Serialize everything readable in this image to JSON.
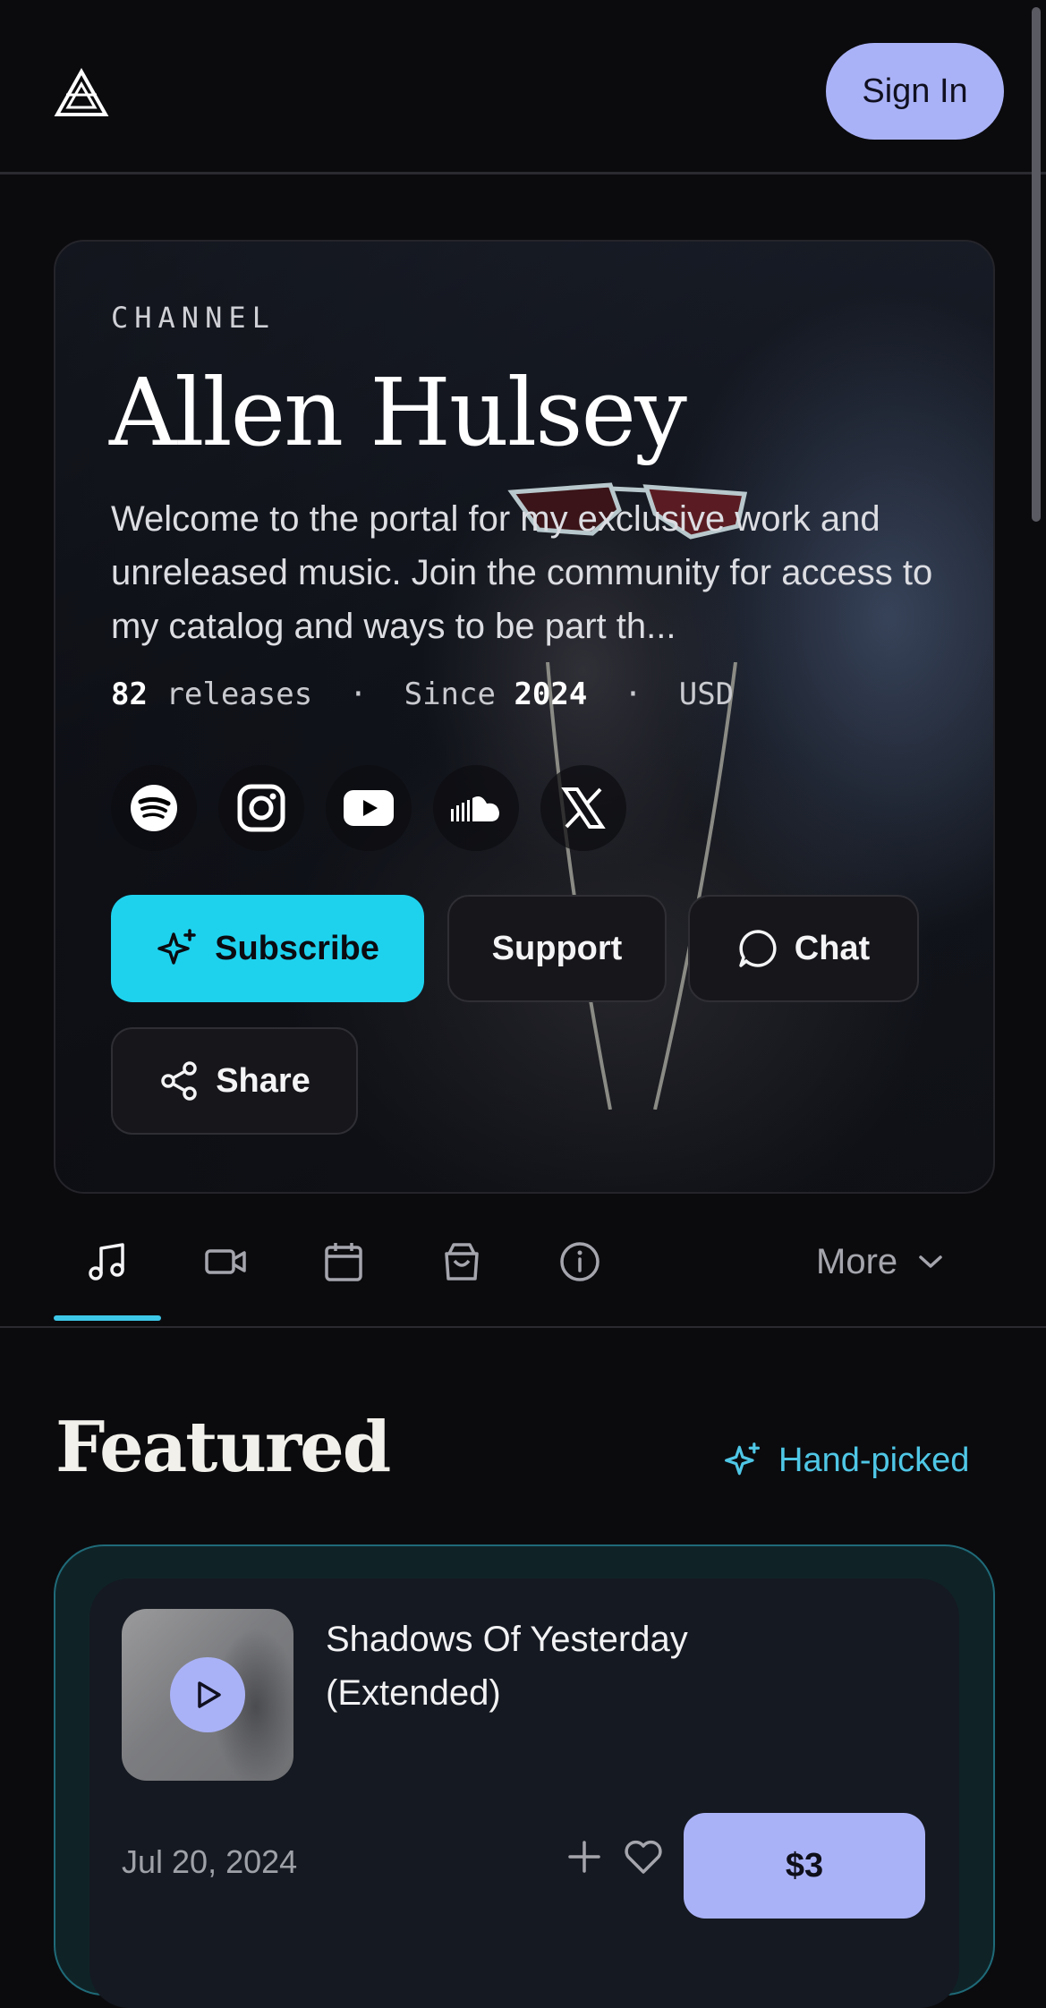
{
  "header": {
    "sign_in_label": "Sign In",
    "logo_icon": "triangle-logo-icon"
  },
  "hero": {
    "kicker": "CHANNEL",
    "name": "Allen Hulsey",
    "bio": "Welcome to the portal for my exclusive work and unreleased music. Join the community for access to my catalog and ways to be part th...",
    "meta": {
      "releases_count": "82",
      "releases_label": "releases",
      "since_label": "Since",
      "since_year": "2024",
      "currency": "USD",
      "separator": "·"
    },
    "socials": [
      "spotify-icon",
      "instagram-icon",
      "youtube-icon",
      "soundcloud-icon",
      "x-icon"
    ],
    "buttons": {
      "subscribe": "Subscribe",
      "support": "Support",
      "chat": "Chat",
      "share": "Share"
    }
  },
  "tabs": {
    "items": [
      "music-icon",
      "video-icon",
      "calendar-icon",
      "shop-bag-icon",
      "info-icon"
    ],
    "more_label": "More",
    "active_index": 0
  },
  "featured": {
    "title": "Featured",
    "badge": "Hand-picked",
    "item": {
      "title": "Shadows Of Yesterday (Extended)",
      "date": "Jul 20, 2024",
      "price": "$3"
    }
  },
  "colors": {
    "accent_cyan": "#1ed2ee",
    "accent_periwinkle": "#aab2f7",
    "background": "#0b0b0e",
    "featured_border": "#1f6a78"
  }
}
